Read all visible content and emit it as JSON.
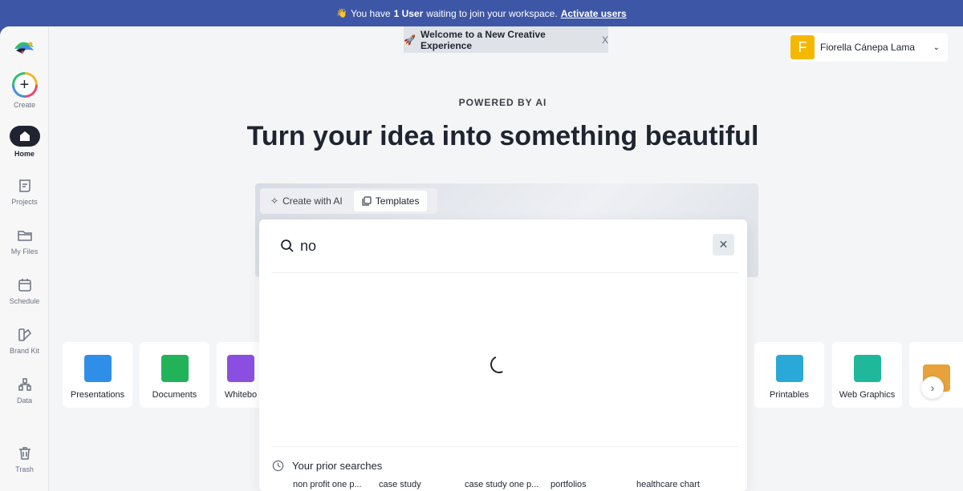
{
  "banner": {
    "prefix": "You have",
    "count": "1 User",
    "suffix": "waiting to join your workspace.",
    "link": "Activate users"
  },
  "sidebar": {
    "items": [
      {
        "label": "Create",
        "icon": "plus-icon"
      },
      {
        "label": "Home",
        "icon": "home-icon",
        "active": true
      },
      {
        "label": "Projects",
        "icon": "projects-icon"
      },
      {
        "label": "My Files",
        "icon": "folder-icon"
      },
      {
        "label": "Schedule",
        "icon": "calendar-icon"
      },
      {
        "label": "Brand Kit",
        "icon": "brand-kit-icon"
      },
      {
        "label": "Data",
        "icon": "data-icon"
      },
      {
        "label": "Trash",
        "icon": "trash-icon"
      }
    ]
  },
  "welcome": {
    "text": "Welcome to a New Creative Experience",
    "close": "X"
  },
  "user": {
    "initial": "F",
    "name": "Fiorella Cánepa Lama"
  },
  "hero": {
    "eyebrow": "POWERED BY AI",
    "headline": "Turn your idea into something beautiful"
  },
  "tabs": [
    {
      "label": "Create with AI",
      "icon": "sparkle-icon"
    },
    {
      "label": "Templates",
      "icon": "templates-icon",
      "active": true
    }
  ],
  "search": {
    "value": "no"
  },
  "prior": {
    "title": "Your prior searches",
    "items": [
      "non profit one p...",
      "case study",
      "case study one p...",
      "portfolios",
      "healthcare chart"
    ]
  },
  "categories": [
    {
      "label": "Presentations",
      "color": "#2f8fe8"
    },
    {
      "label": "Documents",
      "color": "#22b35a"
    },
    {
      "label": "Whitebo",
      "color": "#8a4fe0"
    },
    {
      "label": "Printables",
      "color": "#2aa8d8"
    },
    {
      "label": "Web Graphics",
      "color": "#1fb89a"
    },
    {
      "label": "",
      "color": "#e8a23a"
    }
  ]
}
